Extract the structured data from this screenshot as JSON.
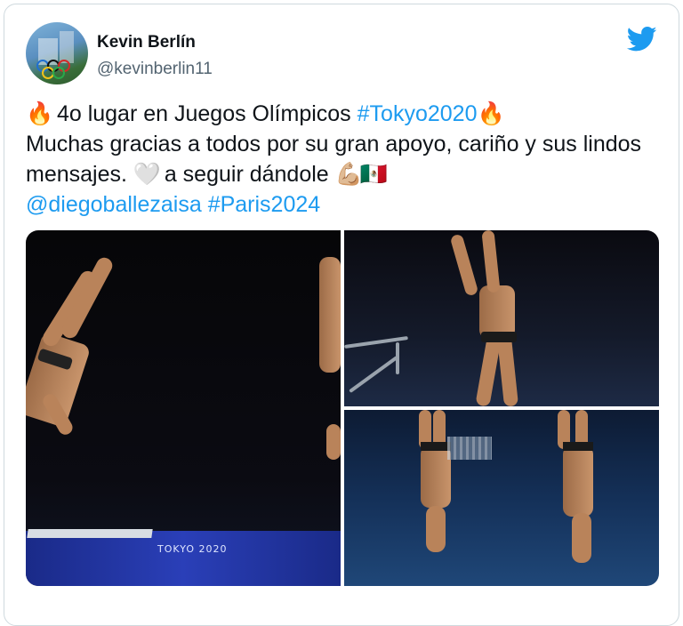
{
  "tweet": {
    "author_name": "Kevin Berlín",
    "author_handle": "@kevinberlin11",
    "line1_fire_left": "🔥",
    "line1_text": " 4o lugar en Juegos Olímpicos ",
    "line1_hashtag": "#Tokyo2020",
    "line1_fire_right": " 🔥",
    "line2_text": "Muchas gracias a todos por su gran apoyo, cariño y sus lindos mensajes. ",
    "line2_heart": "🤍",
    "line2_text_b": " a seguir dándole ",
    "line2_emoji_muscle": "💪🏼",
    "line2_emoji_flag": "🇲🇽",
    "mention": "@diegoballezaisa",
    "hashtag2": "#Paris2024"
  },
  "media": {
    "photo1_venue_text": "TOKYO 2020"
  },
  "colors": {
    "link": "#1d9bf0",
    "border": "#cfd9de",
    "handle": "#536471",
    "twitter_blue": "#1d9bf0"
  },
  "icons": {
    "brand": "twitter-bird-icon"
  }
}
